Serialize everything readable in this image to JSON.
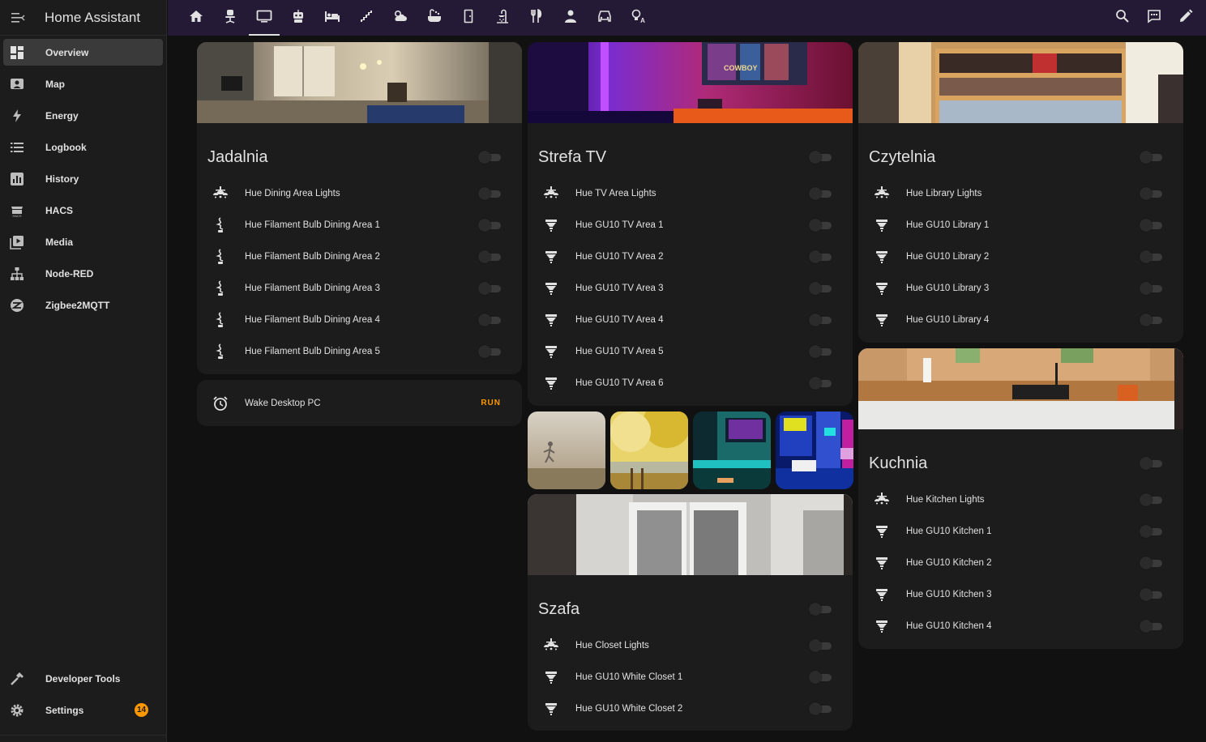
{
  "app": {
    "title": "Home Assistant"
  },
  "sidebar": {
    "items": [
      {
        "label": "Overview",
        "icon": "dashboard-icon",
        "active": true
      },
      {
        "label": "Map",
        "icon": "map-icon"
      },
      {
        "label": "Energy",
        "icon": "lightning-icon"
      },
      {
        "label": "Logbook",
        "icon": "logbook-icon"
      },
      {
        "label": "History",
        "icon": "history-chart-icon"
      },
      {
        "label": "HACS",
        "icon": "hacs-icon"
      },
      {
        "label": "Media",
        "icon": "media-icon"
      },
      {
        "label": "Node-RED",
        "icon": "sitemap-icon"
      },
      {
        "label": "Zigbee2MQTT",
        "icon": "zigbee-icon"
      }
    ],
    "bottom": [
      {
        "label": "Developer Tools",
        "icon": "hammer-icon"
      },
      {
        "label": "Settings",
        "icon": "cog-icon",
        "badge": "14"
      }
    ]
  },
  "topbar": {
    "tabs": [
      "home-icon",
      "desk-chair-icon",
      "tv-icon",
      "robot-icon",
      "bed-icon",
      "stairs-icon",
      "weather-icon",
      "bathtub-icon",
      "door-icon",
      "shower-icon",
      "cutlery-icon",
      "person-icon",
      "car-icon",
      "lightbulb-auto-icon"
    ],
    "active_tab": 2,
    "actions": [
      "search-icon",
      "assist-icon",
      "pencil-icon"
    ]
  },
  "colors": {
    "accent": "#ff9800",
    "topbar": "#241a35",
    "card": "#1c1c1c",
    "background": "#111111"
  },
  "cards": {
    "jadalnia": {
      "title": "Jadalnia",
      "rows": [
        {
          "label": "Hue Dining Area Lights",
          "icon": "ceiling-lights-icon"
        },
        {
          "label": "Hue Filament Bulb Dining Area 1",
          "icon": "filament-bulb-icon"
        },
        {
          "label": "Hue Filament Bulb Dining Area 2",
          "icon": "filament-bulb-icon"
        },
        {
          "label": "Hue Filament Bulb Dining Area 3",
          "icon": "filament-bulb-icon"
        },
        {
          "label": "Hue Filament Bulb Dining Area 4",
          "icon": "filament-bulb-icon"
        },
        {
          "label": "Hue Filament Bulb Dining Area 5",
          "icon": "filament-bulb-icon"
        }
      ]
    },
    "wake": {
      "label": "Wake Desktop PC",
      "action": "RUN",
      "icon": "alarm-clock-icon"
    },
    "strefa": {
      "title": "Strefa TV",
      "rows": [
        {
          "label": "Hue TV Area Lights",
          "icon": "ceiling-lights-icon"
        },
        {
          "label": "Hue GU10 TV Area 1",
          "icon": "spotlight-icon"
        },
        {
          "label": "Hue GU10 TV Area 2",
          "icon": "spotlight-icon"
        },
        {
          "label": "Hue GU10 TV Area 3",
          "icon": "spotlight-icon"
        },
        {
          "label": "Hue GU10 TV Area 4",
          "icon": "spotlight-icon"
        },
        {
          "label": "Hue GU10 TV Area 5",
          "icon": "spotlight-icon"
        },
        {
          "label": "Hue GU10 TV Area 6",
          "icon": "spotlight-icon"
        }
      ]
    },
    "szafa": {
      "title": "Szafa",
      "rows": [
        {
          "label": "Hue Closet Lights",
          "icon": "ceiling-lights-icon"
        },
        {
          "label": "Hue GU10 White Closet 1",
          "icon": "spotlight-icon"
        },
        {
          "label": "Hue GU10 White Closet 2",
          "icon": "spotlight-icon"
        }
      ]
    },
    "czytelnia": {
      "title": "Czytelnia",
      "rows": [
        {
          "label": "Hue Library Lights",
          "icon": "ceiling-lights-icon"
        },
        {
          "label": "Hue GU10 Library 1",
          "icon": "spotlight-icon"
        },
        {
          "label": "Hue GU10 Library 2",
          "icon": "spotlight-icon"
        },
        {
          "label": "Hue GU10 Library 3",
          "icon": "spotlight-icon"
        },
        {
          "label": "Hue GU10 Library 4",
          "icon": "spotlight-icon"
        }
      ]
    },
    "kuchnia": {
      "title": "Kuchnia",
      "rows": [
        {
          "label": "Hue Kitchen Lights",
          "icon": "ceiling-lights-icon"
        },
        {
          "label": "Hue GU10 Kitchen 1",
          "icon": "spotlight-icon"
        },
        {
          "label": "Hue GU10 Kitchen 2",
          "icon": "spotlight-icon"
        },
        {
          "label": "Hue GU10 Kitchen 3",
          "icon": "spotlight-icon"
        },
        {
          "label": "Hue GU10 Kitchen 4",
          "icon": "spotlight-icon"
        }
      ]
    }
  },
  "scenes": [
    "foggy-runner-scene",
    "autumn-lake-scene",
    "tv-ambient-scene",
    "neon-city-scene"
  ]
}
